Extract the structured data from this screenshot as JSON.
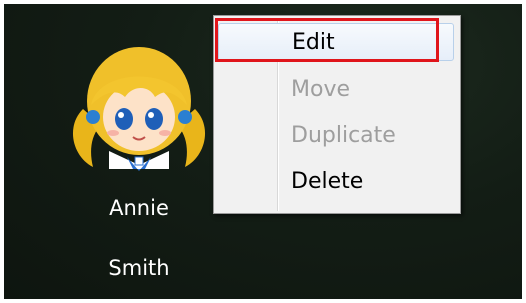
{
  "contact": {
    "first_name": "Annie",
    "last_name": "Smith",
    "avatar_icon": "cartoon-girl-avatar"
  },
  "context_menu": {
    "items": [
      {
        "label": "Edit",
        "enabled": true,
        "highlighted": true
      },
      {
        "label": "Move",
        "enabled": false,
        "highlighted": false
      },
      {
        "label": "Duplicate",
        "enabled": false,
        "highlighted": false
      },
      {
        "label": "Delete",
        "enabled": true,
        "highlighted": false
      }
    ]
  },
  "colors": {
    "background": "#131d15",
    "highlight_box": "#e0151b",
    "menu_background": "#f1f1f1",
    "disabled_text": "#9e9e9e"
  }
}
